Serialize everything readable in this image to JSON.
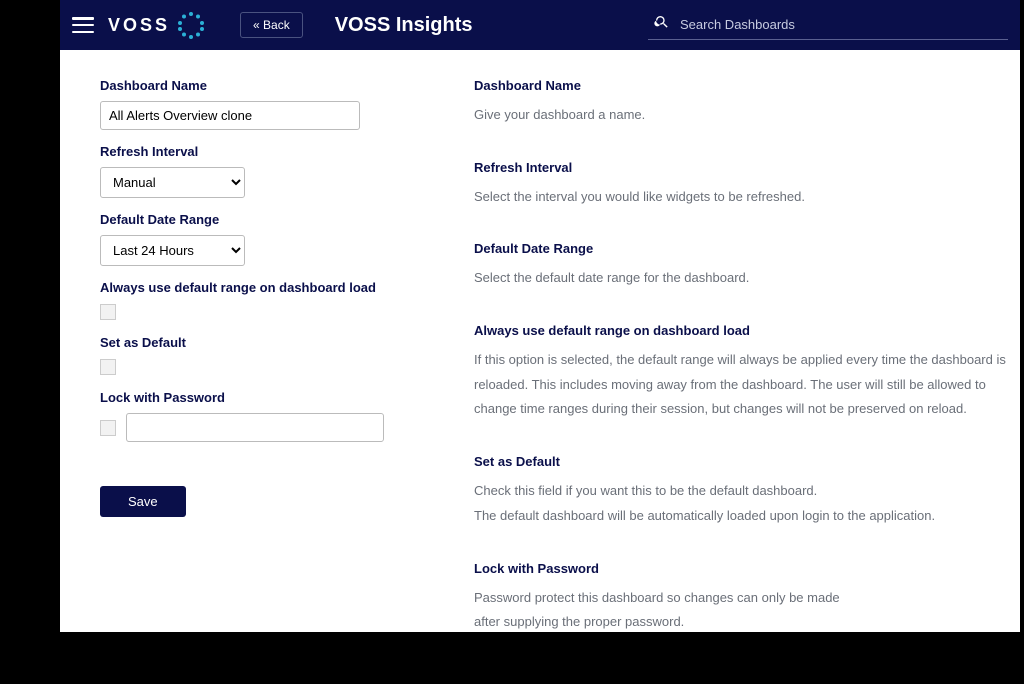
{
  "header": {
    "logo_text": "VOSS",
    "back_label": "« Back",
    "title": "VOSS Insights",
    "search_placeholder": "Search Dashboards"
  },
  "form": {
    "dashboard_name_label": "Dashboard Name",
    "dashboard_name_value": "All Alerts Overview clone",
    "refresh_interval_label": "Refresh Interval",
    "refresh_interval_value": "Manual",
    "default_date_range_label": "Default Date Range",
    "default_date_range_value": "Last 24 Hours",
    "always_use_default_label": "Always use default range on dashboard load",
    "set_as_default_label": "Set as Default",
    "lock_password_label": "Lock with Password",
    "save_label": "Save"
  },
  "help": {
    "dashboard_name": {
      "title": "Dashboard Name",
      "text": "Give your dashboard a name."
    },
    "refresh_interval": {
      "title": "Refresh Interval",
      "text": "Select the interval you would like widgets to be refreshed."
    },
    "default_date_range": {
      "title": "Default Date Range",
      "text": "Select the default date range for the dashboard."
    },
    "always_use_default": {
      "title": "Always use default range on dashboard load",
      "text": "If this option is selected, the default range will always be applied every time the dashboard is reloaded. This includes moving away from the dashboard. The user will still be allowed to change time ranges during their session, but changes will not be preserved on reload."
    },
    "set_as_default": {
      "title": "Set as Default",
      "line1": "Check this field if you want this to be the default dashboard.",
      "line2": "The default dashboard will be automatically loaded upon login to the application."
    },
    "lock_password": {
      "title": "Lock with Password",
      "line1": "Password protect this dashboard so changes can only be made",
      "line2": "after supplying the proper password."
    }
  }
}
